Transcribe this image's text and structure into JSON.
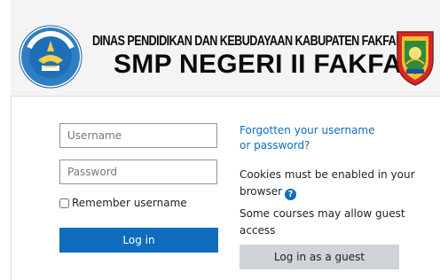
{
  "header": {
    "agency": "DINAS PENDIDIKAN DAN KEBUDAYAAN KABUPATEN FAKFAK",
    "school": "SMP NEGERI II FAKFAK",
    "logo_left": "tut-wuri-handayani-emblem",
    "logo_right": "fakfak-regency-crest"
  },
  "login": {
    "username_placeholder": "Username",
    "password_placeholder": "Password",
    "remember_label": "Remember username",
    "login_button": "Log in"
  },
  "info": {
    "forgot_link": "Forgotten your username or password?",
    "cookies_text": "Cookies must be enabled in your browser",
    "help_icon": "question-circle-icon",
    "guest_note": "Some courses may allow guest access",
    "guest_button": "Log in as a guest"
  },
  "colors": {
    "primary": "#0f6cbf",
    "secondary_button": "#ced4da",
    "header_bg": "#f4f4f4"
  }
}
